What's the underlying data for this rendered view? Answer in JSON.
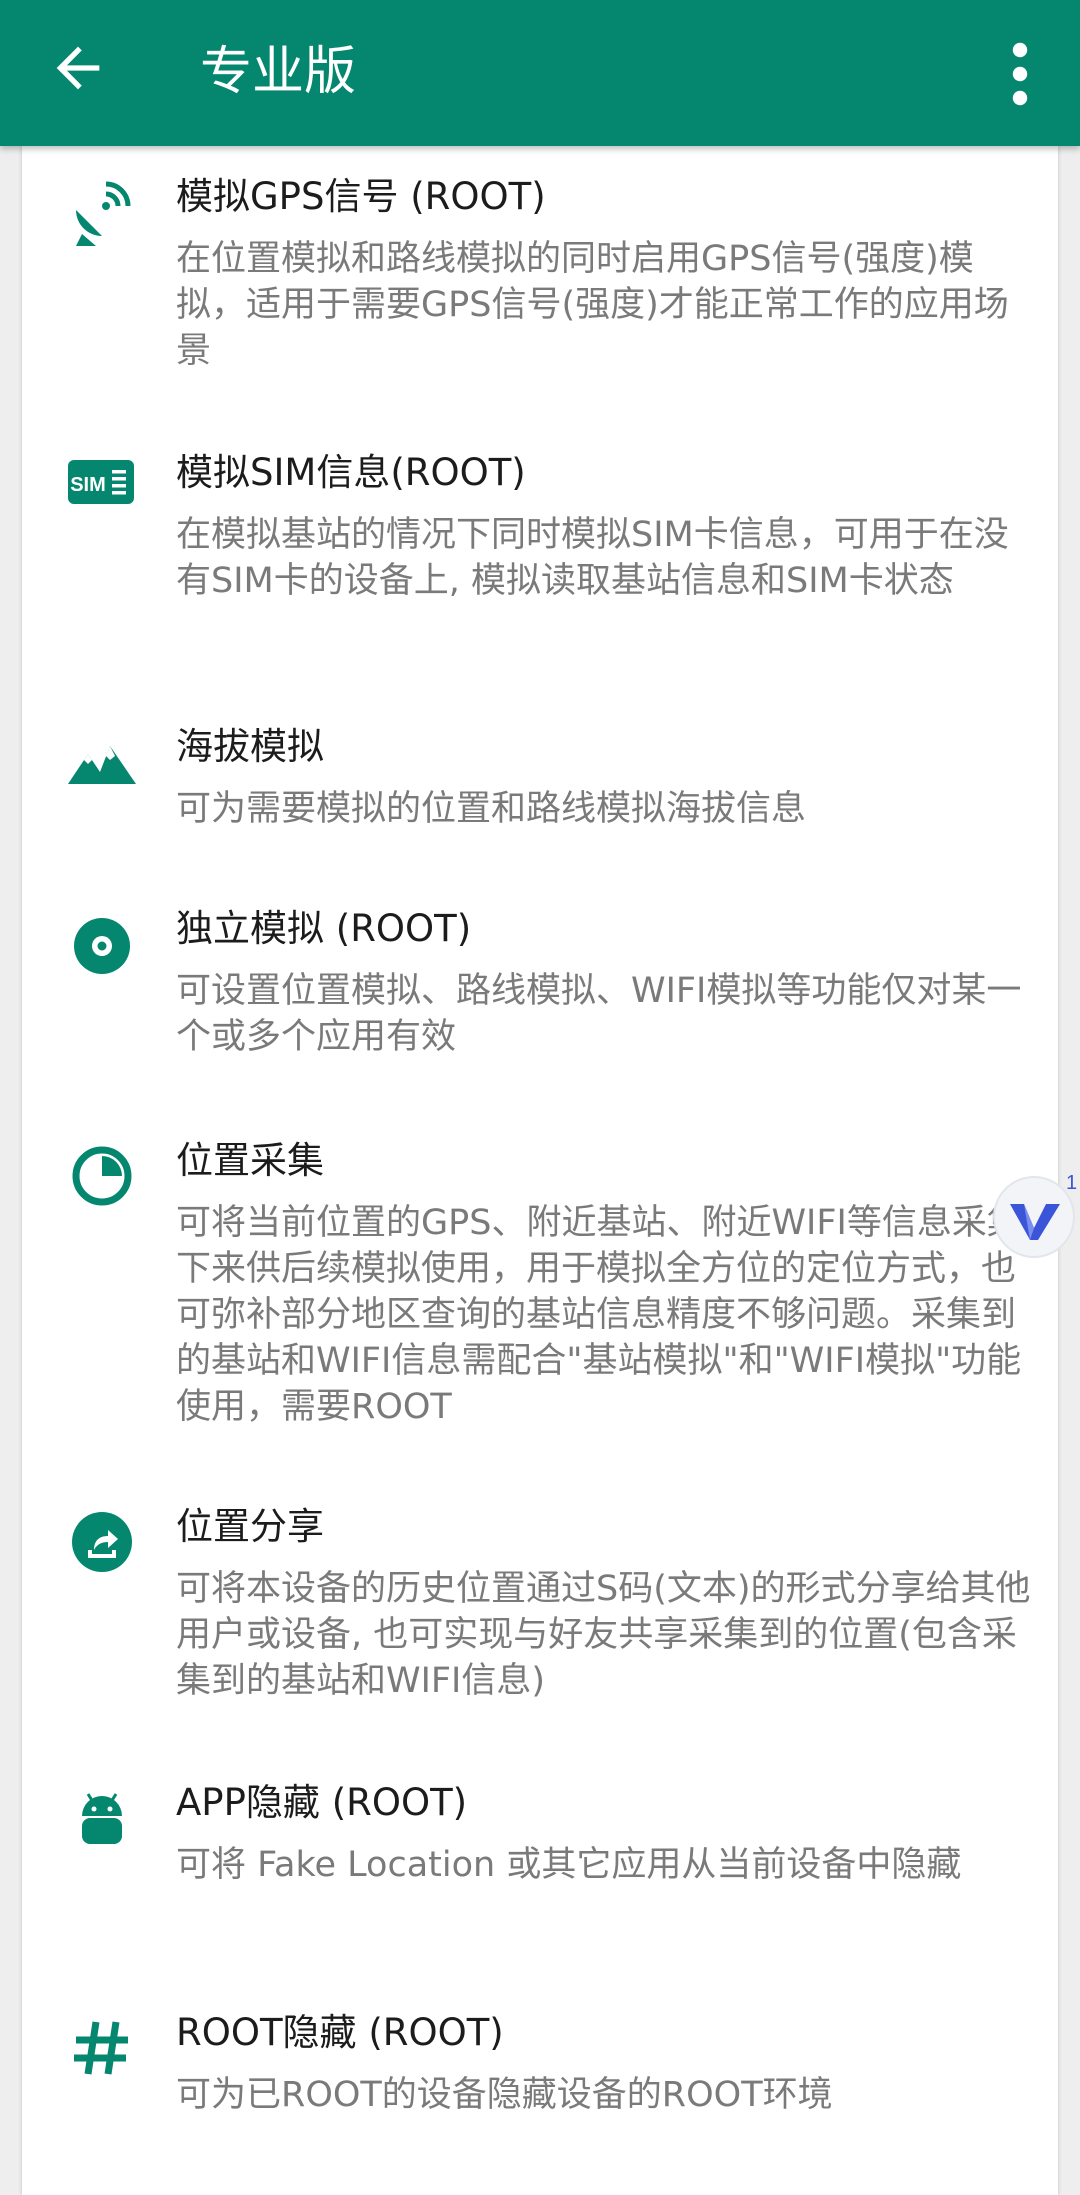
{
  "appbar": {
    "title": "专业版",
    "back_icon": "arrow-left-icon",
    "more_icon": "more-vert-icon"
  },
  "colors": {
    "primary": "#05876f",
    "title_text": "#1c1c1c",
    "desc_text": "#7a7a7a"
  },
  "items": [
    {
      "icon": "satellite-dish-icon",
      "title": "模拟GPS信号 (ROOT)",
      "desc": "在位置模拟和路线模拟的同时启用GPS信号(强度)模拟，适用于需要GPS信号(强度)才能正常工作的应用场景"
    },
    {
      "icon": "sim-card-icon",
      "title": "模拟SIM信息(ROOT)",
      "desc": "在模拟基站的情况下同时模拟SIM卡信息，可用于在没有SIM卡的设备上, 模拟读取基站信息和SIM卡状态"
    },
    {
      "icon": "mountains-icon",
      "title": "海拔模拟",
      "desc": "可为需要模拟的位置和路线模拟海拔信息"
    },
    {
      "icon": "target-circle-icon",
      "title": "独立模拟 (ROOT)",
      "desc": "可设置位置模拟、路线模拟、WIFI模拟等功能仅对某一个或多个应用有效"
    },
    {
      "icon": "pie-chart-icon",
      "title": "位置采集",
      "desc": "可将当前位置的GPS、附近基站、附近WIFI等信息采集下来供后续模拟使用，用于模拟全方位的定位方式，也可弥补部分地区查询的基站信息精度不够问题。采集到的基站和WIFI信息需配合\"基站模拟\"和\"WIFI模拟\"功能使用，需要ROOT"
    },
    {
      "icon": "share-icon",
      "title": "位置分享",
      "desc": "可将本设备的历史位置通过S码(文本)的形式分享给其他用户或设备, 也可实现与好友共享采集到的位置(包含采集到的基站和WIFI信息)"
    },
    {
      "icon": "android-icon",
      "title": "APP隐藏 (ROOT)",
      "desc": "可将 Fake Location 或其它应用从当前设备中隐藏"
    },
    {
      "icon": "hash-icon",
      "title": "ROOT隐藏 (ROOT)",
      "desc": "可为已ROOT的设备隐藏设备的ROOT环境"
    }
  ],
  "floating_badge": {
    "icon": "v-logo-icon",
    "count": "1"
  }
}
